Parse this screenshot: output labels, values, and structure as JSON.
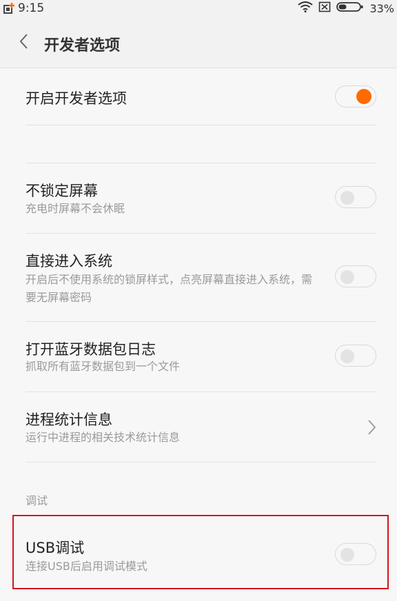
{
  "status_bar": {
    "time": "9:15",
    "battery_percent": "33%",
    "icons": [
      "app-notification-icon",
      "wifi-icon",
      "sim-off-icon",
      "battery-icon"
    ]
  },
  "header": {
    "back_icon": "chevron-left-icon",
    "title": "开发者选项"
  },
  "settings": {
    "enable_dev": {
      "title": "开启开发者选项",
      "state": "on"
    },
    "stay_awake": {
      "title": "不锁定屏幕",
      "subtitle": "充电时屏幕不会休眠",
      "state": "off"
    },
    "skip_lock": {
      "title": "直接进入系统",
      "subtitle": "开启后不使用系统的锁屏样式，点亮屏幕直接进入系统，需要无屏幕密码",
      "state": "off"
    },
    "bt_log": {
      "title": "打开蓝牙数据包日志",
      "subtitle": "抓取所有蓝牙数据包到一个文件",
      "state": "off"
    },
    "process_stats": {
      "title": "进程统计信息",
      "subtitle": "运行中进程的相关技术统计信息"
    },
    "debug_section": "调试",
    "usb_debug": {
      "title": "USB调试",
      "subtitle": "连接USB后启用调试模式",
      "state": "off"
    }
  },
  "colors": {
    "accent": "#ff6a00",
    "highlight_border": "#d3131a"
  }
}
